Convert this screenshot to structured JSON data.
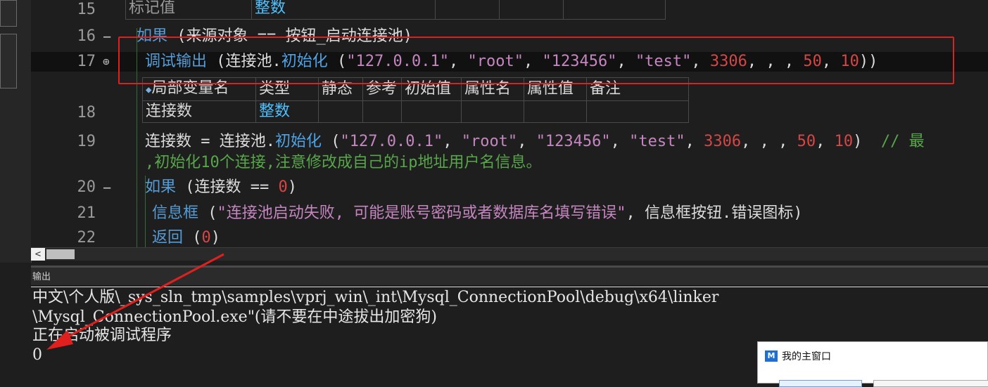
{
  "editor": {
    "lines": [
      {
        "num": "15",
        "fold": ""
      },
      {
        "num": "16",
        "fold": "−"
      },
      {
        "num": "17",
        "fold": "⊕"
      },
      {
        "num": "18",
        "fold": ""
      },
      {
        "num": "19",
        "fold": ""
      },
      {
        "num": "20",
        "fold": "−"
      },
      {
        "num": "21",
        "fold": ""
      },
      {
        "num": "22",
        "fold": ""
      }
    ],
    "row15": {
      "c1": "标记值",
      "c2": "整数"
    },
    "row16": {
      "kw": "如果",
      "rest": " (来源对象 == 按钮_启动连接池)"
    },
    "row17": {
      "kw": "调试输出",
      "open": " (连接池.",
      "fn": "初始化",
      "args_open": " (",
      "s1": "\"127.0.0.1\"",
      "sep1": ", ",
      "s2": "\"root\"",
      "sep2": ", ",
      "s3": "\"123456\"",
      "sep3": ", ",
      "s4": "\"test\"",
      "sep4": ", ",
      "n1": "3306",
      "sep5": ", , , ",
      "n2": "50",
      "sep6": ", ",
      "n3": "10",
      "close": "))"
    },
    "vartable": {
      "headers": [
        "局部变量名",
        "类型",
        "静态",
        "参考",
        "初始值",
        "属性名",
        "属性值",
        "备注"
      ],
      "row": [
        "连接数",
        "整数",
        "",
        "",
        "",
        "",
        "",
        ""
      ]
    },
    "row19": {
      "lhs": "连接数 = 连接池.",
      "fn": "初始化",
      "args_open": " (",
      "s1": "\"127.0.0.1\"",
      "sep1": ", ",
      "s2": "\"root\"",
      "sep2": ", ",
      "s3": "\"123456\"",
      "sep3": ", ",
      "s4": "\"test\"",
      "sep4": ", ",
      "n1": "3306",
      "sep5": ", , , ",
      "n2": "50",
      "sep6": ", ",
      "n3": "10",
      "close": ")",
      "comment": "  // 最",
      "comment2": ",初始化10个连接,注意修改成自己的ip地址用户名信息。"
    },
    "row20": {
      "kw": "如果",
      "rest": " (连接数 == ",
      "n": "0",
      "close": ")"
    },
    "row21": {
      "kw": "信息框",
      "open": " (",
      "s": "\"连接池启动失败, 可能是账号密码或者数据库名填写错误\"",
      "rest": ", 信息框按钮.错误图标)"
    },
    "row22": {
      "kw": "返回",
      "open": " (",
      "n": "0",
      "close": ")"
    }
  },
  "scrollbar": {
    "left_arrow": "<"
  },
  "output": {
    "header": "输出",
    "lines": [
      "中文\\个人版\\_sys_sln_tmp\\samples\\vprj_win\\_int\\Mysql_ConnectionPool\\debug\\x64\\linker",
      "\\Mysql_ConnectionPool.exe\"(请不要在中途拔出加密狗)",
      "正在启动被调试程序",
      "0"
    ]
  },
  "popup": {
    "icon": "M",
    "title": "我的主窗口"
  },
  "colors": {
    "annotation": "#e0201e"
  }
}
